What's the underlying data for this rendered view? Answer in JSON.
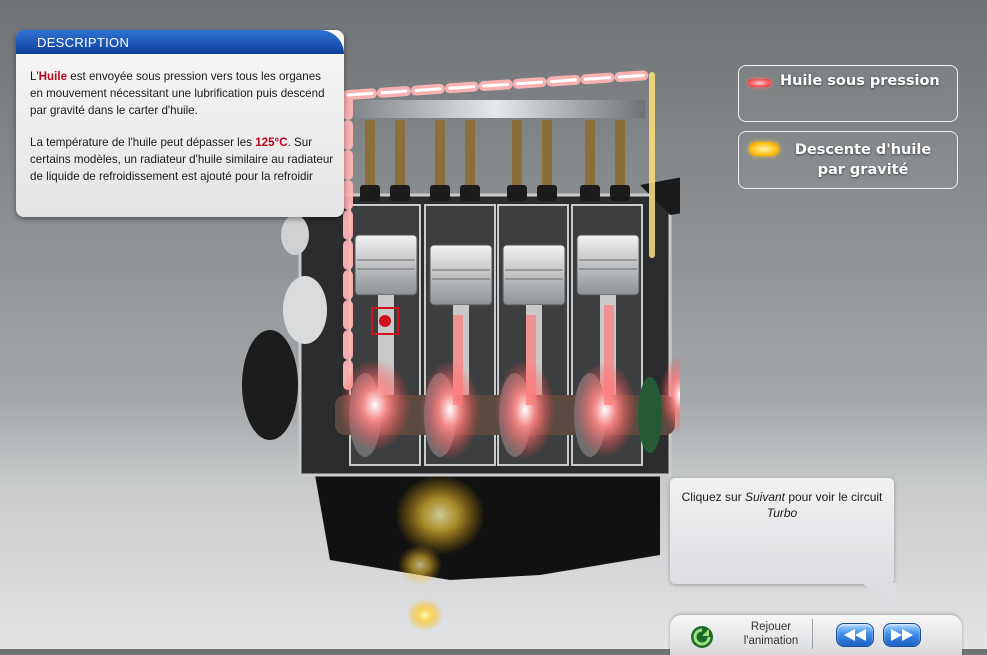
{
  "description": {
    "header": "DESCRIPTION",
    "p1": {
      "prefix": "L'",
      "highlight": "Huile",
      "rest": " est envoyée sous pression vers tous les organes en mouvement nécessitant une lubrification puis descend par gravité dans le carter d'huile."
    },
    "p2": {
      "prefix": "La température de l'huile peut dépasser les ",
      "highlight": "125°C",
      "rest": ". Sur certains modèles, un radiateur d'huile similaire au radiateur de liquide de refroidissement est ajouté pour la refroidir"
    }
  },
  "legend": [
    {
      "label": "Huile sous pression",
      "icon": "red-oil-swatch",
      "color": "#ff5f5f"
    },
    {
      "label_line1": "Descente d'huile",
      "label_line2": "par gravité",
      "icon": "yellow-oil-swatch",
      "color": "#ffc41c"
    }
  ],
  "info": {
    "part1": "Cliquez sur ",
    "suivant": "Suivant",
    "part2": " pour voir le circuit ",
    "turbo": "Turbo"
  },
  "controls": {
    "replay_line1": "Rejouer",
    "replay_line2": "l'animation",
    "prev_icon": "rewind-icon",
    "next_icon": "fast-forward-icon"
  },
  "colors": {
    "header_blue": "#1f5bbf",
    "highlight_red": "#b8001a"
  }
}
